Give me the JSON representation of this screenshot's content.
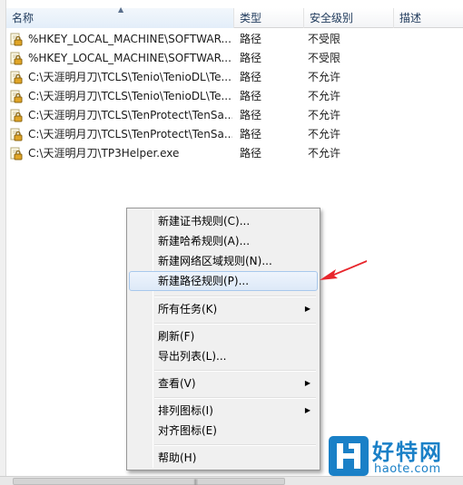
{
  "columns": {
    "name": "名称",
    "type": "类型",
    "level": "安全级别",
    "desc": "描述"
  },
  "rows": [
    {
      "name": "%HKEY_LOCAL_MACHINE\\SOFTWAR...",
      "type": "路径",
      "level": "不受限"
    },
    {
      "name": "%HKEY_LOCAL_MACHINE\\SOFTWAR...",
      "type": "路径",
      "level": "不受限"
    },
    {
      "name": "C:\\天涯明月刀\\TCLS\\Tenio\\TenioDL\\Te...",
      "type": "路径",
      "level": "不允许"
    },
    {
      "name": "C:\\天涯明月刀\\TCLS\\Tenio\\TenioDL\\Te...",
      "type": "路径",
      "level": "不允许"
    },
    {
      "name": "C:\\天涯明月刀\\TCLS\\TenProtect\\TenSa...",
      "type": "路径",
      "level": "不允许"
    },
    {
      "name": "C:\\天涯明月刀\\TCLS\\TenProtect\\TenSa...",
      "type": "路径",
      "level": "不允许"
    },
    {
      "name": "C:\\天涯明月刀\\TP3Helper.exe",
      "type": "路径",
      "level": "不允许"
    }
  ],
  "menu": {
    "new_cert_rule": "新建证书规则(C)...",
    "new_hash_rule": "新建哈希规则(A)...",
    "new_zone_rule": "新建网络区域规则(N)...",
    "new_path_rule": "新建路径规则(P)...",
    "all_tasks": "所有任务(K)",
    "refresh": "刷新(F)",
    "export_list": "导出列表(L)...",
    "view": "查看(V)",
    "arrange_icons": "排列图标(I)",
    "align_icons": "对齐图标(E)",
    "help": "帮助(H)"
  },
  "watermark": {
    "name": "好特网",
    "url": "haote.com"
  },
  "icons": {
    "row_icon": "lock-document-icon",
    "pointer": "red-arrow-icon",
    "logo": "haote-logo-icon"
  },
  "colors": {
    "arrow": "#e8262c",
    "watermark": "#1a80c7",
    "menu_highlight": "#dde9f8"
  }
}
